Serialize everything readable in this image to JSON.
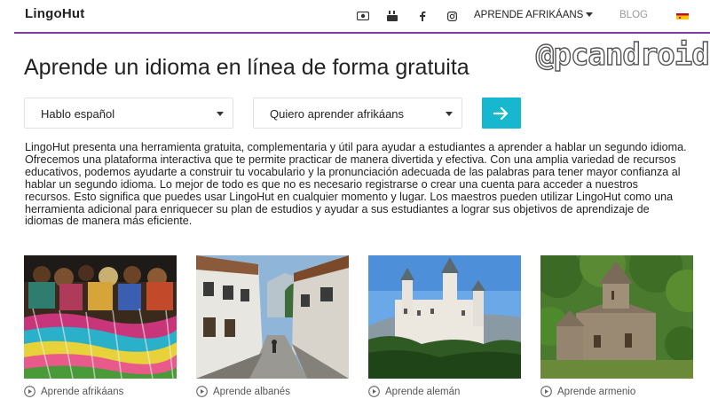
{
  "header": {
    "logo": "LingoHut",
    "icons": [
      "video-icon",
      "youtube-icon",
      "facebook-icon",
      "instagram-icon"
    ],
    "language_menu": "APRENDE AFRIKÁANS",
    "blog": "BLOG",
    "flag": "spain-flag-icon"
  },
  "watermark": "@pcandroid",
  "main": {
    "title": "Aprende un idioma en línea de forma gratuita",
    "select_native": "Hablo español",
    "select_target": "Quiero aprender afrikáans",
    "go_button_icon": "arrow-right-icon",
    "intro": "LingoHut presenta una herramienta gratuita, complementaria y útil para ayudar a estudiantes a aprender a hablar un segundo idioma. Ofrecemos una plataforma interactiva que te permite practicar de manera divertida y efectiva. Con una amplia variedad de recursos educativos, podemos ayudarte a construir tu vocabulario y la pronunciación adecuada de las palabras para tener mayor confianza al hablar un segundo idioma. Lo mejor de todo es que no es necesario registrarse o crear una cuenta para acceder a nuestros recursos. Esto significa que puedes usar LingoHut en cualquier momento y lugar. Los maestros pueden utilizar LingoHut como una herramienta adicional para enriquecer su plan de estudios y ayudar a sus estudiantes a lograr sus objetivos de aprendizaje de idiomas de manera más eficiente."
  },
  "cards": [
    {
      "label": "Aprende afrikáans"
    },
    {
      "label": "Aprende albanés"
    },
    {
      "label": "Aprende alemán"
    },
    {
      "label": "Aprende armenio"
    }
  ],
  "colors": {
    "accent": "#7b3fa1",
    "button": "#17b8cf"
  }
}
